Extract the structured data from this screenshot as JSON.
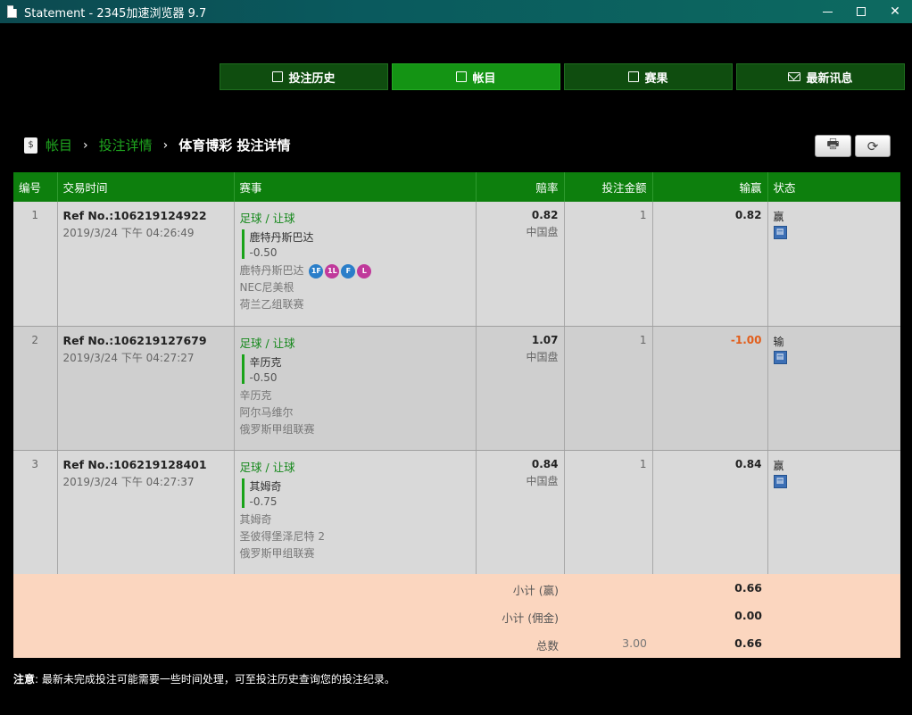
{
  "window": {
    "title": "Statement - 2345加速浏览器 9.7"
  },
  "nav": {
    "tabs": [
      {
        "label": "投注历史",
        "icon": "history-icon"
      },
      {
        "label": "帐目",
        "icon": "ledger-icon",
        "active": true
      },
      {
        "label": "赛果",
        "icon": "results-icon"
      },
      {
        "label": "最新讯息",
        "icon": "mail-icon"
      }
    ]
  },
  "breadcrumb": {
    "root": "帐目",
    "middle": "投注详情",
    "current": "体育博彩 投注详情",
    "sep": "›"
  },
  "table": {
    "headers": {
      "no": "编号",
      "time": "交易时间",
      "event": "赛事",
      "odds": "赔率",
      "stake": "投注金额",
      "winloss": "输赢",
      "status": "状态"
    },
    "rows": [
      {
        "no": "1",
        "ref": "Ref No.:106219124922",
        "time": "2019/3/24 下午 04:26:49",
        "sport": "足球 / 让球",
        "selection": "鹿特丹斯巴达",
        "handicap": "-0.50",
        "home": "鹿特丹斯巴达",
        "away": "NEC尼美根",
        "league": "荷兰乙组联赛",
        "odds": "0.82",
        "oddsType": "中国盘",
        "stake": "1",
        "winloss": "0.82",
        "status": "赢"
      },
      {
        "no": "2",
        "ref": "Ref No.:106219127679",
        "time": "2019/3/24 下午 04:27:27",
        "sport": "足球 / 让球",
        "selection": "辛历克",
        "handicap": "-0.50",
        "home": "辛历克",
        "away": "阿尔马维尔",
        "league": "俄罗斯甲组联赛",
        "odds": "1.07",
        "oddsType": "中国盘",
        "stake": "1",
        "winloss": "-1.00",
        "status": "输"
      },
      {
        "no": "3",
        "ref": "Ref No.:106219128401",
        "time": "2019/3/24 下午 04:27:37",
        "sport": "足球 / 让球",
        "selection": "其姆奇",
        "handicap": "-0.75",
        "home": "其姆奇",
        "away": "圣彼得堡泽尼特 2",
        "league": "俄罗斯甲组联赛",
        "odds": "0.84",
        "oddsType": "中国盘",
        "stake": "1",
        "winloss": "0.84",
        "status": "赢"
      }
    ],
    "badges": [
      "1F",
      "1L",
      "F",
      "L"
    ]
  },
  "summary": {
    "subtotal_win_label": "小计 (赢)",
    "subtotal_win": "0.66",
    "subtotal_comm_label": "小计 (佣金)",
    "subtotal_comm": "0.00",
    "total_label": "总数",
    "total_stake": "3.00",
    "total": "0.66"
  },
  "note": {
    "prefix": "注意",
    "text": ": 最新未完成投注可能需要一些时间处理，可至投注历史查询您的投注纪录。"
  },
  "colors": {
    "accent": "#149414",
    "header": "#0d7f0d",
    "loss": "#e25d1a",
    "summary_bg": "#fbd6bf"
  }
}
